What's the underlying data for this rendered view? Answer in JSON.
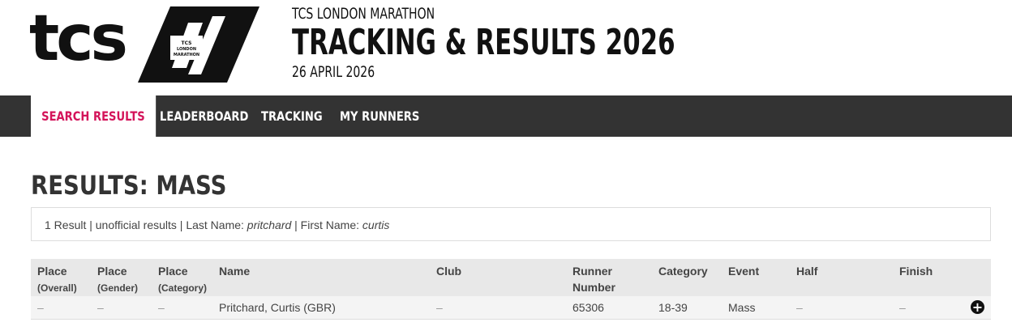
{
  "header": {
    "logo_text": "tcs",
    "logo_badge_lines": [
      "TCS",
      "LONDON",
      "MARATHON"
    ],
    "subtitle": "TCS LONDON MARATHON",
    "title": "TRACKING & RESULTS 2026",
    "date": "26 APRIL 2026"
  },
  "nav": {
    "items": [
      {
        "label": "SEARCH RESULTS",
        "active": true
      },
      {
        "label": "LEADERBOARD",
        "active": false
      },
      {
        "label": "TRACKING",
        "active": false
      },
      {
        "label": "MY RUNNERS",
        "active": false
      }
    ]
  },
  "page_title": "RESULTS: MASS",
  "summary": {
    "prefix": "1 Result | unofficial results | Last Name: ",
    "last_name": "pritchard",
    "middle": " | First Name: ",
    "first_name": "curtis"
  },
  "table": {
    "headers": {
      "place_overall": [
        "Place",
        "(Overall)"
      ],
      "place_gender": [
        "Place",
        "(Gender)"
      ],
      "place_category": [
        "Place",
        "(Category)"
      ],
      "name": "Name",
      "club": "Club",
      "runner_number": [
        "Runner",
        "Number"
      ],
      "category": "Category",
      "event": "Event",
      "half": "Half",
      "finish": "Finish"
    },
    "rows": [
      {
        "place_overall": "–",
        "place_gender": "–",
        "place_category": "–",
        "name": "Pritchard, Curtis (GBR)",
        "club": "–",
        "runner_number": "65306",
        "category": "18-39",
        "event": "Mass",
        "half": "–",
        "finish": "–"
      }
    ]
  },
  "icons": {
    "expand": "plus-circle-icon"
  },
  "colors": {
    "accent": "#d4145a",
    "nav_bg": "#333333"
  }
}
